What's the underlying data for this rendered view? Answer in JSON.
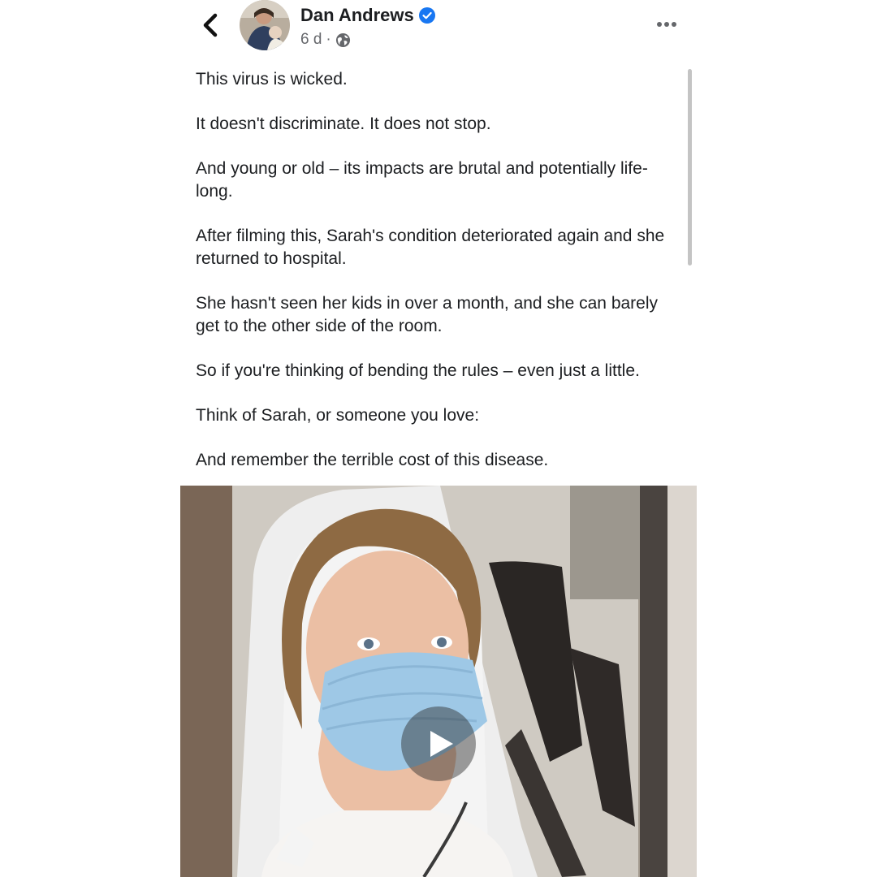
{
  "header": {
    "author_name": "Dan Andrews",
    "time": "6 d",
    "separator": "·",
    "icons": {
      "back": "chevron-left-icon",
      "verified": "verified-badge-icon",
      "audience": "globe-icon",
      "more": "more-options-icon"
    }
  },
  "post": {
    "paragraphs": [
      "This virus is wicked.",
      "It doesn't discriminate. It does not stop.",
      "And young or old – its impacts are brutal and potentially life-long.",
      "After filming this, Sarah's condition deteriorated again and she returned to hospital.",
      "She hasn't seen her kids in over a month, and she can barely get to the other side of the room.",
      "So if you're thinking of bending the rules – even just a little.",
      "Think of Sarah, or someone you love:",
      "And remember the terrible cost of this disease."
    ]
  },
  "video": {
    "play_icon": "play-icon"
  },
  "colors": {
    "text": "#1c1e21",
    "meta": "#65676b",
    "verified": "#1877f2",
    "mask": "#9ec8e6"
  }
}
